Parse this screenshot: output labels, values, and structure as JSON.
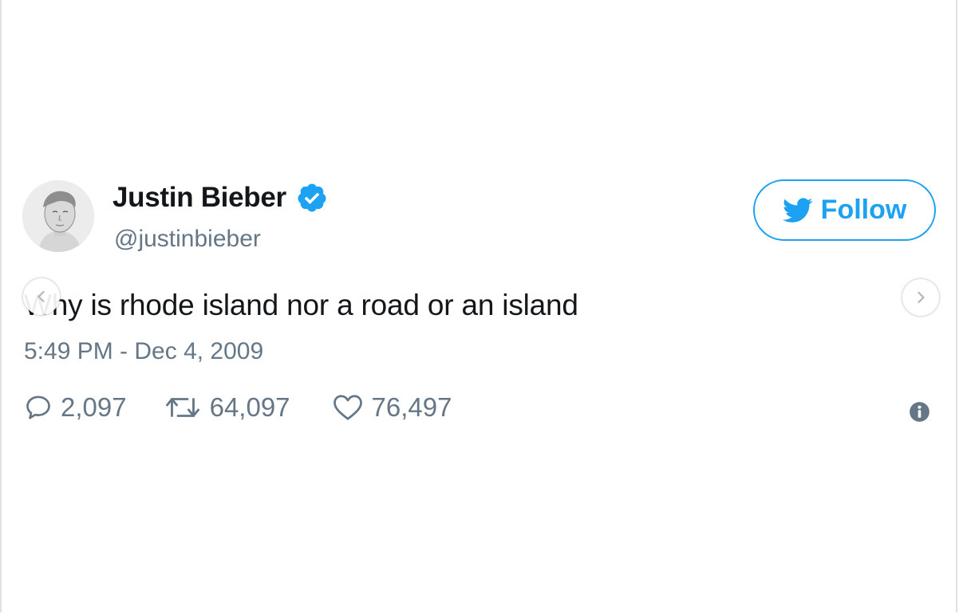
{
  "tweet": {
    "display_name": "Justin Bieber",
    "handle": "@justinbieber",
    "text": "Why is rhode island nor a road or an island",
    "timestamp": "5:49 PM - Dec 4, 2009",
    "replies": "2,097",
    "retweets": "64,097",
    "likes": "76,497"
  },
  "follow_button": {
    "label": "Follow"
  },
  "icons": {
    "verified": "verified-badge-icon",
    "bird": "twitter-bird-icon",
    "reply": "reply-bubble-icon",
    "retweet": "retweet-icon",
    "like": "heart-icon",
    "info": "info-icon",
    "prev": "chevron-left-icon",
    "next": "chevron-right-icon"
  },
  "colors": {
    "accent": "#1da1f2",
    "text": "#14171a",
    "muted": "#657786"
  }
}
